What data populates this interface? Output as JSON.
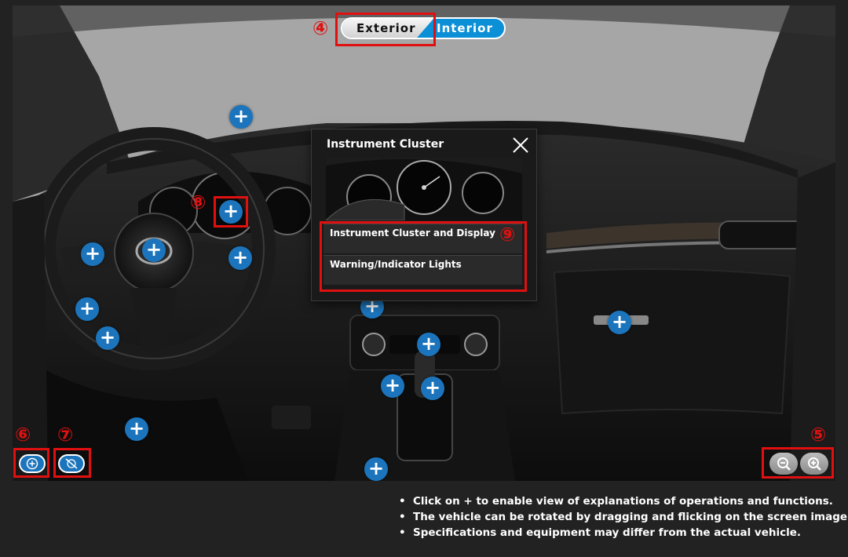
{
  "view_toggle": {
    "exterior_label": "Exterior",
    "interior_label": "Interior",
    "active": "interior"
  },
  "markers": {
    "m4": "④",
    "m5": "⑤",
    "m6": "⑥",
    "m7": "⑦",
    "m8": "⑧",
    "m9": "⑨"
  },
  "hotspot_symbol": "+",
  "popup": {
    "title": "Instrument Cluster",
    "links": [
      "Instrument Cluster and Display",
      "Warning/Indicator Lights"
    ]
  },
  "controls": {
    "icons": {
      "hotspot_toggle": "plus-circle-icon",
      "hide_hotspots": "hotspot-off-icon",
      "zoom_out": "zoom-out-icon",
      "zoom_in": "zoom-in-icon"
    }
  },
  "notes": [
    "Click on + to enable view of explanations of operations and functions.",
    "The vehicle can be rotated by dragging and flicking on the screen image.",
    "Specifications and equipment may differ from the actual vehicle."
  ],
  "colors": {
    "accent_blue": "#1c75bc",
    "annotation_red": "#e01010",
    "background": "#222222"
  }
}
